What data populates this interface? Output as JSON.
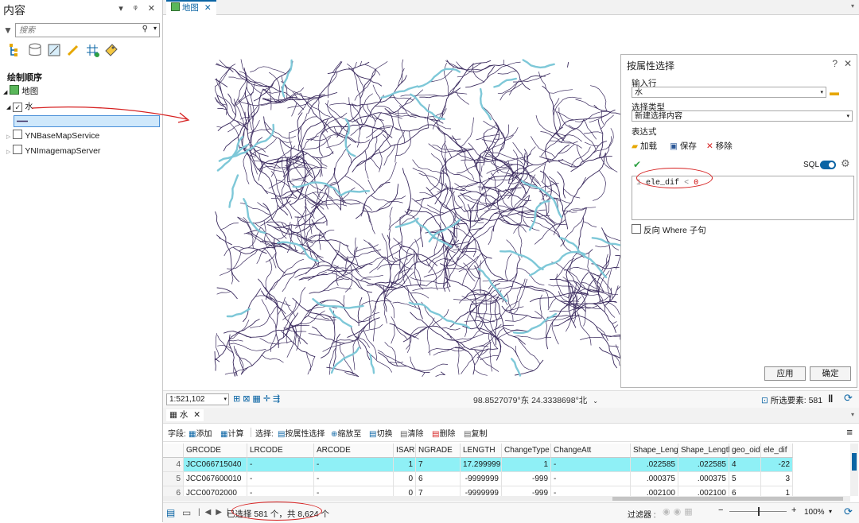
{
  "contents": {
    "title": "内容",
    "controls": "▾ ᵠ ✕",
    "search_placeholder": "搜索",
    "drawing_order": "绘制顺序",
    "layers": [
      {
        "label": "地图",
        "checked": true
      },
      {
        "label": "水",
        "checked": true
      },
      {
        "label": "YNBaseMapService",
        "checked": false
      },
      {
        "label": "YNImagemapServer",
        "checked": false
      }
    ]
  },
  "map_tab": {
    "label": "地图"
  },
  "dialog": {
    "title": "按属性选择",
    "help": "?",
    "close": "✕",
    "input_rows_label": "输入行",
    "input_rows_value": "水",
    "selection_type_label": "选择类型",
    "selection_type_value": "新建选择内容",
    "expression_label": "表达式",
    "load": "加载",
    "save": "保存",
    "remove": "移除",
    "sql": "SQL",
    "expression": {
      "line": "1",
      "field": "ele_dif",
      "op": "<",
      "value": "0"
    },
    "invert_where": "反向 Where 子句",
    "apply": "应用",
    "ok": "确定"
  },
  "map_status": {
    "scale": "1:521,102",
    "coordinates": "98.8527079°东 24.3338698°北",
    "selected_features": "所选要素: 581"
  },
  "table": {
    "tab_label": "水",
    "toolbar": {
      "fields_label": "字段:",
      "add": "添加",
      "calculate": "计算",
      "selection_label": "选择:",
      "select_by_attr": "按属性选择",
      "zoom_to": "缩放至",
      "switch": "切换",
      "clear": "清除",
      "delete": "删除",
      "copy": "复制"
    },
    "columns": [
      "GRCODE",
      "LRCODE",
      "ARCODE",
      "ISAR",
      "NGRADE",
      "LENGTH",
      "ChangeType",
      "ChangeAtt",
      "Shape_Leng",
      "Shape_Length",
      "geo_oid",
      "ele_dif"
    ],
    "rows": [
      {
        "num": "4",
        "cells": [
          "JCC066715040",
          "-",
          "-",
          "1",
          "7",
          "17.299999",
          "1",
          "-",
          ".022585",
          ".022585",
          "4",
          "-22"
        ],
        "selected": true
      },
      {
        "num": "5",
        "cells": [
          "JCC067600010",
          "-",
          "-",
          "0",
          "6",
          "-9999999",
          "-999",
          "-",
          ".000375",
          ".000375",
          "5",
          "3"
        ],
        "selected": false
      },
      {
        "num": "6",
        "cells": [
          "JCC00702000",
          "-",
          "-",
          "0",
          "7",
          "-9999999",
          "-999",
          "-",
          ".002100",
          ".002100",
          "6",
          "1"
        ],
        "selected": false
      }
    ],
    "status": "已选择 581 个，共 8,624 个",
    "filter_label": "过滤器 :",
    "zoom": "100%"
  },
  "colors": {
    "accent": "#0a64a4",
    "selected_row": "#8ff0f6",
    "river": "#3a2a5e",
    "river_main": "#7ec8d8",
    "annotation": "#d62020"
  }
}
